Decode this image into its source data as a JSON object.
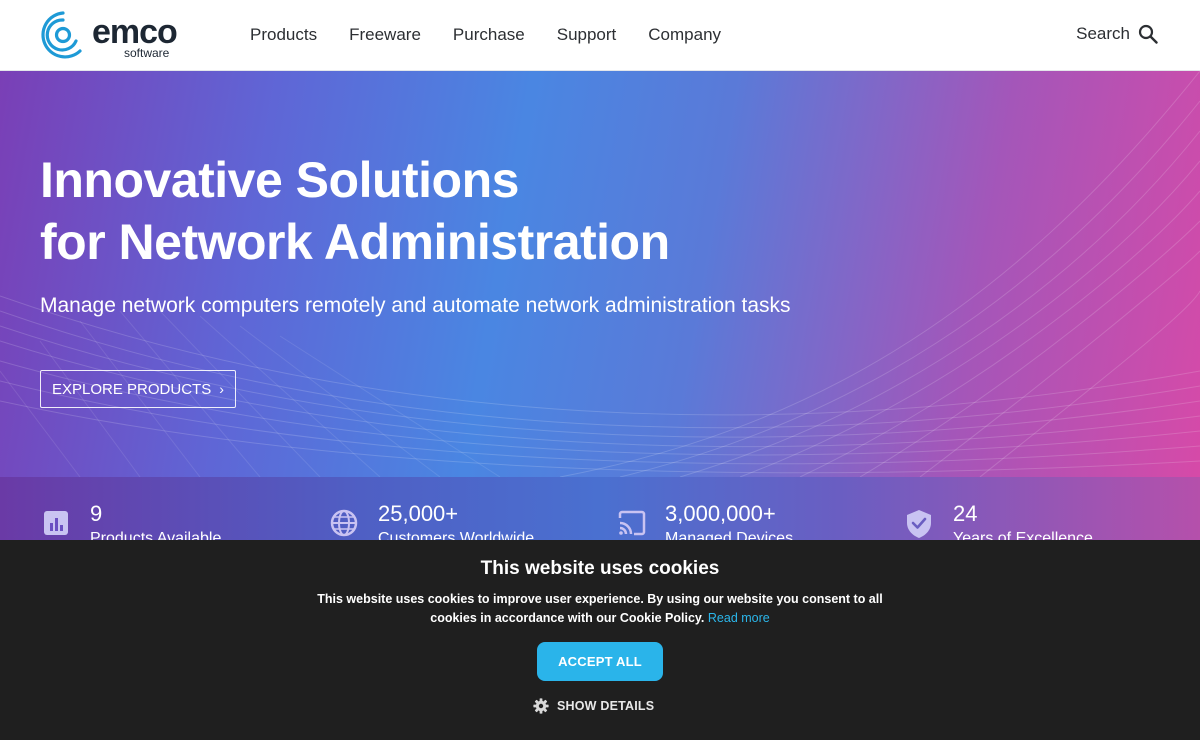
{
  "header": {
    "logo_word": "emco",
    "logo_sub": "software",
    "nav": [
      "Products",
      "Freeware",
      "Purchase",
      "Support",
      "Company"
    ],
    "search_label": "Search"
  },
  "hero": {
    "title_line1": "Innovative Solutions",
    "title_line2": "for Network Administration",
    "subtitle": "Manage network computers remotely and automate network administration tasks",
    "cta_label": "EXPLORE PRODUCTS"
  },
  "stats": [
    {
      "value": "9",
      "label": "Products Available",
      "icon": "bar-chart-icon"
    },
    {
      "value": "25,000+",
      "label": "Customers Worldwide",
      "icon": "globe-icon"
    },
    {
      "value": "3,000,000+",
      "label": "Managed Devices",
      "icon": "cast-icon"
    },
    {
      "value": "24",
      "label": "Years of Excellence",
      "icon": "shield-check-icon"
    }
  ],
  "cookie": {
    "title": "This website uses cookies",
    "text": "This website uses cookies to improve user experience. By using our website you consent to all cookies in accordance with our Cookie Policy.",
    "read_more": "Read more",
    "accept_label": "ACCEPT ALL",
    "details_label": "SHOW DETAILS"
  },
  "colors": {
    "accent": "#2ab4ea",
    "logo_blue": "#1e9ad6",
    "banner_bg": "#1f1f1f"
  }
}
